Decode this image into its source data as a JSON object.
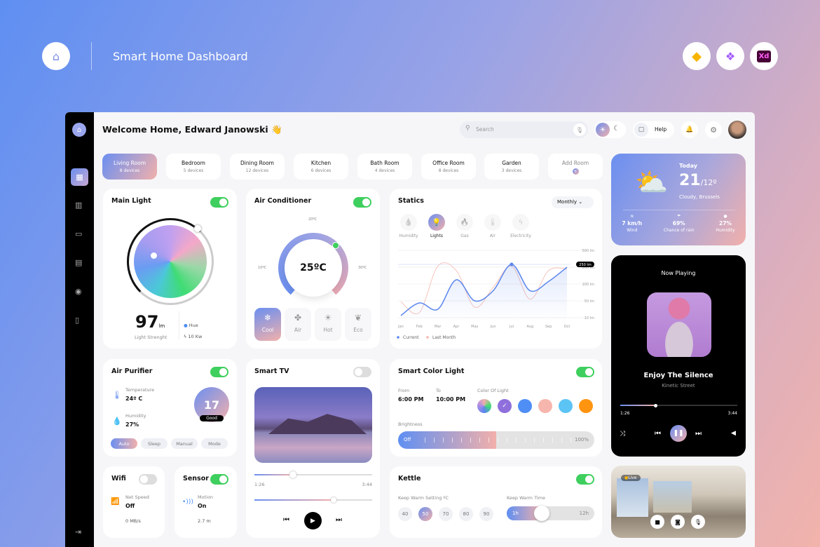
{
  "header": {
    "title": "Smart Home Dashboard",
    "tools": [
      "sketch-icon",
      "figma-icon",
      "xd-icon"
    ],
    "xd_label": "Xd"
  },
  "topbar": {
    "welcome": "Welcome Home, Edward Janowski",
    "wave": "👋",
    "search_placeholder": "Search",
    "help": "Help"
  },
  "sidebar": {
    "items": [
      "dashboard-icon",
      "building-icon",
      "devices-icon",
      "calendar-icon",
      "energy-icon",
      "clipboard-icon"
    ],
    "logout": "logout-icon"
  },
  "rooms": [
    {
      "name": "Living Room",
      "devices": "8 devices",
      "active": true
    },
    {
      "name": "Bedroom",
      "devices": "5 devices"
    },
    {
      "name": "Dining Room",
      "devices": "12 devices"
    },
    {
      "name": "Kitchen",
      "devices": "6 devices"
    },
    {
      "name": "Bath Room",
      "devices": "4 devices"
    },
    {
      "name": "Office Room",
      "devices": "8 devices"
    },
    {
      "name": "Garden",
      "devices": "3 devices"
    },
    {
      "name": "Add Room",
      "devices": ""
    }
  ],
  "main_light": {
    "title": "Main Light",
    "on": true,
    "value": "97",
    "unit": "lm",
    "caption": "Light Strenght",
    "hue": "Hue",
    "power": "10 Kw"
  },
  "ac": {
    "title": "Air Conditioner",
    "on": true,
    "temp": "25ºC",
    "t20": "20ºC",
    "t10": "10ºC",
    "t30": "30ºC",
    "modes": [
      "Cool",
      "Air",
      "Hot",
      "Eco"
    ],
    "active_mode": "Cool"
  },
  "statics": {
    "title": "Statics",
    "period": "Monthly",
    "categories": [
      "Humidity",
      "Lights",
      "Gas",
      "Air",
      "Electricity"
    ],
    "active": "Lights"
  },
  "chart_data": {
    "type": "line",
    "categories": [
      "Jan",
      "Feb",
      "Mar",
      "Apr",
      "May",
      "Jun",
      "Jul",
      "Aug",
      "Sep",
      "Oct"
    ],
    "y_ticks": [
      "500 lm",
      "200 lm",
      "100 lm",
      "50 lm",
      "10 lm"
    ],
    "y_tick_values": [
      500,
      200,
      100,
      50,
      10
    ],
    "highlight": {
      "label": "250 lm",
      "value": 250,
      "x": "Jul"
    },
    "series": [
      {
        "name": "Current",
        "color": "#5b86ee",
        "values": [
          15,
          45,
          30,
          125,
          50,
          80,
          250,
          80,
          115,
          200
        ]
      },
      {
        "name": "Last Month",
        "color": "#f5b6ad",
        "values": [
          48,
          22,
          220,
          180,
          35,
          90,
          220,
          55,
          180,
          190
        ]
      }
    ],
    "grid": true,
    "legend": "bottom-left"
  },
  "weather": {
    "label": "Today",
    "high": "21",
    "low": "/12º",
    "desc": "Cloudy, Brussels",
    "wind": "7 km/h",
    "wind_label": "Wind",
    "rain": "69%",
    "rain_label": "Chance of rain",
    "humidity": "27%",
    "humidity_label": "Humidity"
  },
  "music": {
    "title": "Now Playing",
    "song": "Enjoy The Silence",
    "artist": "Kinetic Street",
    "elapsed": "1:26",
    "total": "3:44",
    "progress": 0.3
  },
  "camera": {
    "live": "Live"
  },
  "purifier": {
    "title": "Air Purifier",
    "on": true,
    "temp_label": "Temperature",
    "temp": "24º C",
    "hum_label": "Humidity",
    "hum": "27%",
    "aqi": "17",
    "aqi_label": "Good",
    "modes": [
      "Auto",
      "Sleep",
      "Manual",
      "Mode"
    ]
  },
  "tv": {
    "title": "Smart TV",
    "on": false,
    "elapsed": "1:26",
    "total": "3:44",
    "progress": 0.33,
    "volume": 0.67
  },
  "color_light": {
    "title": "Smart Color Light",
    "on": true,
    "from_label": "From",
    "from": "6:00 PM",
    "to_label": "To",
    "to": "10:00 PM",
    "color_label": "Color Of Light",
    "colors": [
      "#multi",
      "#8f6fdc",
      "#4f8ef5",
      "#f7b6ad",
      "#5cc4f5",
      "#ff9410"
    ],
    "brightness_label": "Brightness",
    "off": "Off",
    "max": "100%",
    "brightness": 0.5
  },
  "wifi": {
    "title": "Wifi",
    "on": false,
    "label": "Net Speed",
    "value": "Off",
    "speed": "0 MB/s"
  },
  "sensor": {
    "title": "Sensor",
    "on": true,
    "label": "Motion",
    "value": "On",
    "dist": "2.7 m"
  },
  "kettle": {
    "title": "Kettle",
    "on": true,
    "temp_label": "Keep Warm Setting ºC",
    "temps": [
      "40",
      "50",
      "70",
      "80",
      "90"
    ],
    "active": "50",
    "time_label": "Keep Warm Time",
    "min": "1h",
    "max": "12h",
    "time": 0.4
  }
}
